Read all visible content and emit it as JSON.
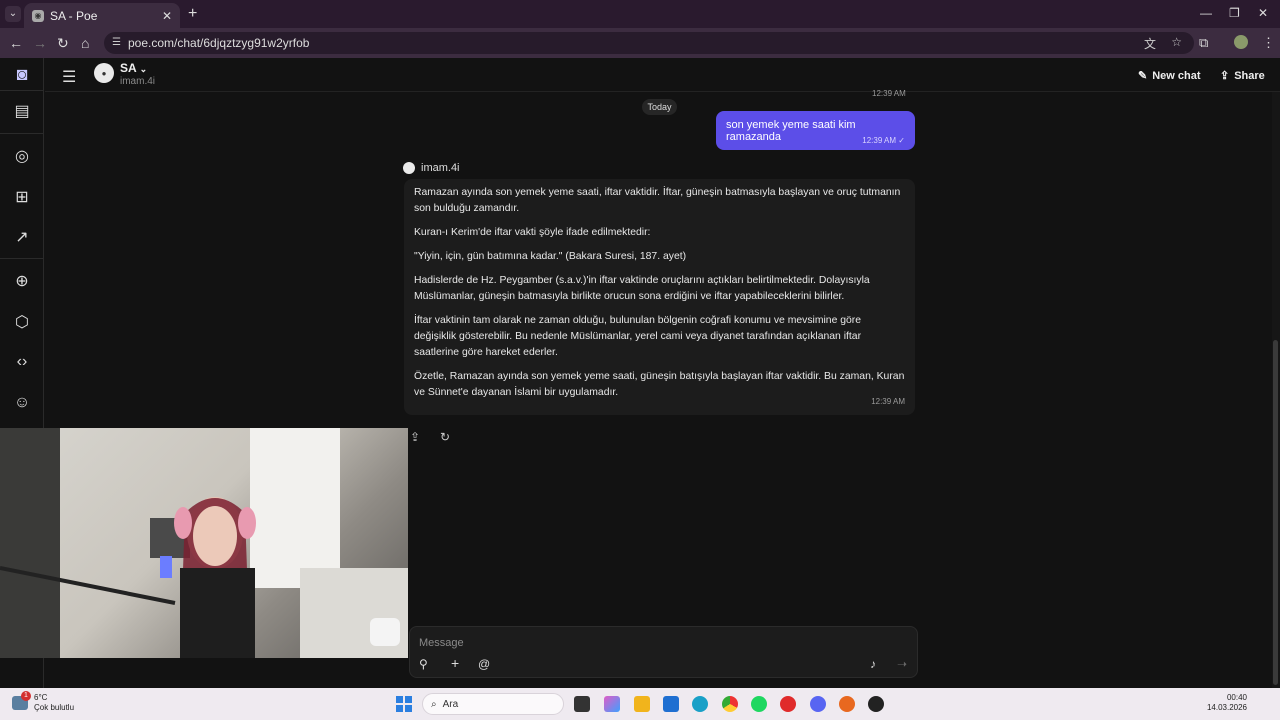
{
  "browser": {
    "tab_title": "SA - Poe",
    "url": "poe.com/chat/6djqztzyg91w2yrfob"
  },
  "app": {
    "bot_name": "SA",
    "bot_handle": "imam.4i",
    "new_chat_label": "New chat",
    "share_label": "Share"
  },
  "chat": {
    "prev_time": "12:39 AM",
    "day_label": "Today",
    "user_message": "son yemek yeme saati kim ramazanda",
    "user_time": "12:39 AM",
    "bot_label": "imam.4i",
    "bot_paragraphs": [
      "Ramazan ayında son yemek yeme saati, iftar vaktidir. İftar, güneşin batmasıyla başlayan ve oruç tutmanın son bulduğu zamandır.",
      "Kuran-ı Kerim'de iftar vakti şöyle ifade edilmektedir:",
      "\"Yiyin, için, gün batımına kadar.\" (Bakara Suresi, 187. ayet)",
      "Hadislerde de Hz. Peygamber (s.a.v.)'in iftar vaktinde oruçlarını açtıkları belirtilmektedir. Dolayısıyla Müslümanlar, güneşin batmasıyla birlikte orucun sona erdiğini ve iftar yapabileceklerini bilirler.",
      "İftar vaktinin tam olarak ne zaman olduğu, bulunulan bölgenin coğrafi konumu ve mevsimine göre değişiklik gösterebilir. Bu nedenle Müslümanlar, yerel cami veya diyanet tarafından açıklanan iftar saatlerine göre hareket ederler.",
      "Özetle, Ramazan ayında son yemek yeme saati, güneşin batışıyla başlayan iftar vaktidir. Bu zaman, Kuran ve Sünnet'e dayanan İslami bir uygulamadır."
    ],
    "bot_time": "12:39 AM"
  },
  "composer": {
    "placeholder": "Message"
  },
  "taskbar": {
    "weather_temp": "6°C",
    "weather_desc": "Çok bulutlu",
    "weather_badge": "1",
    "search_label": "Ara",
    "time": "00:40",
    "date": "14.03.2026"
  }
}
